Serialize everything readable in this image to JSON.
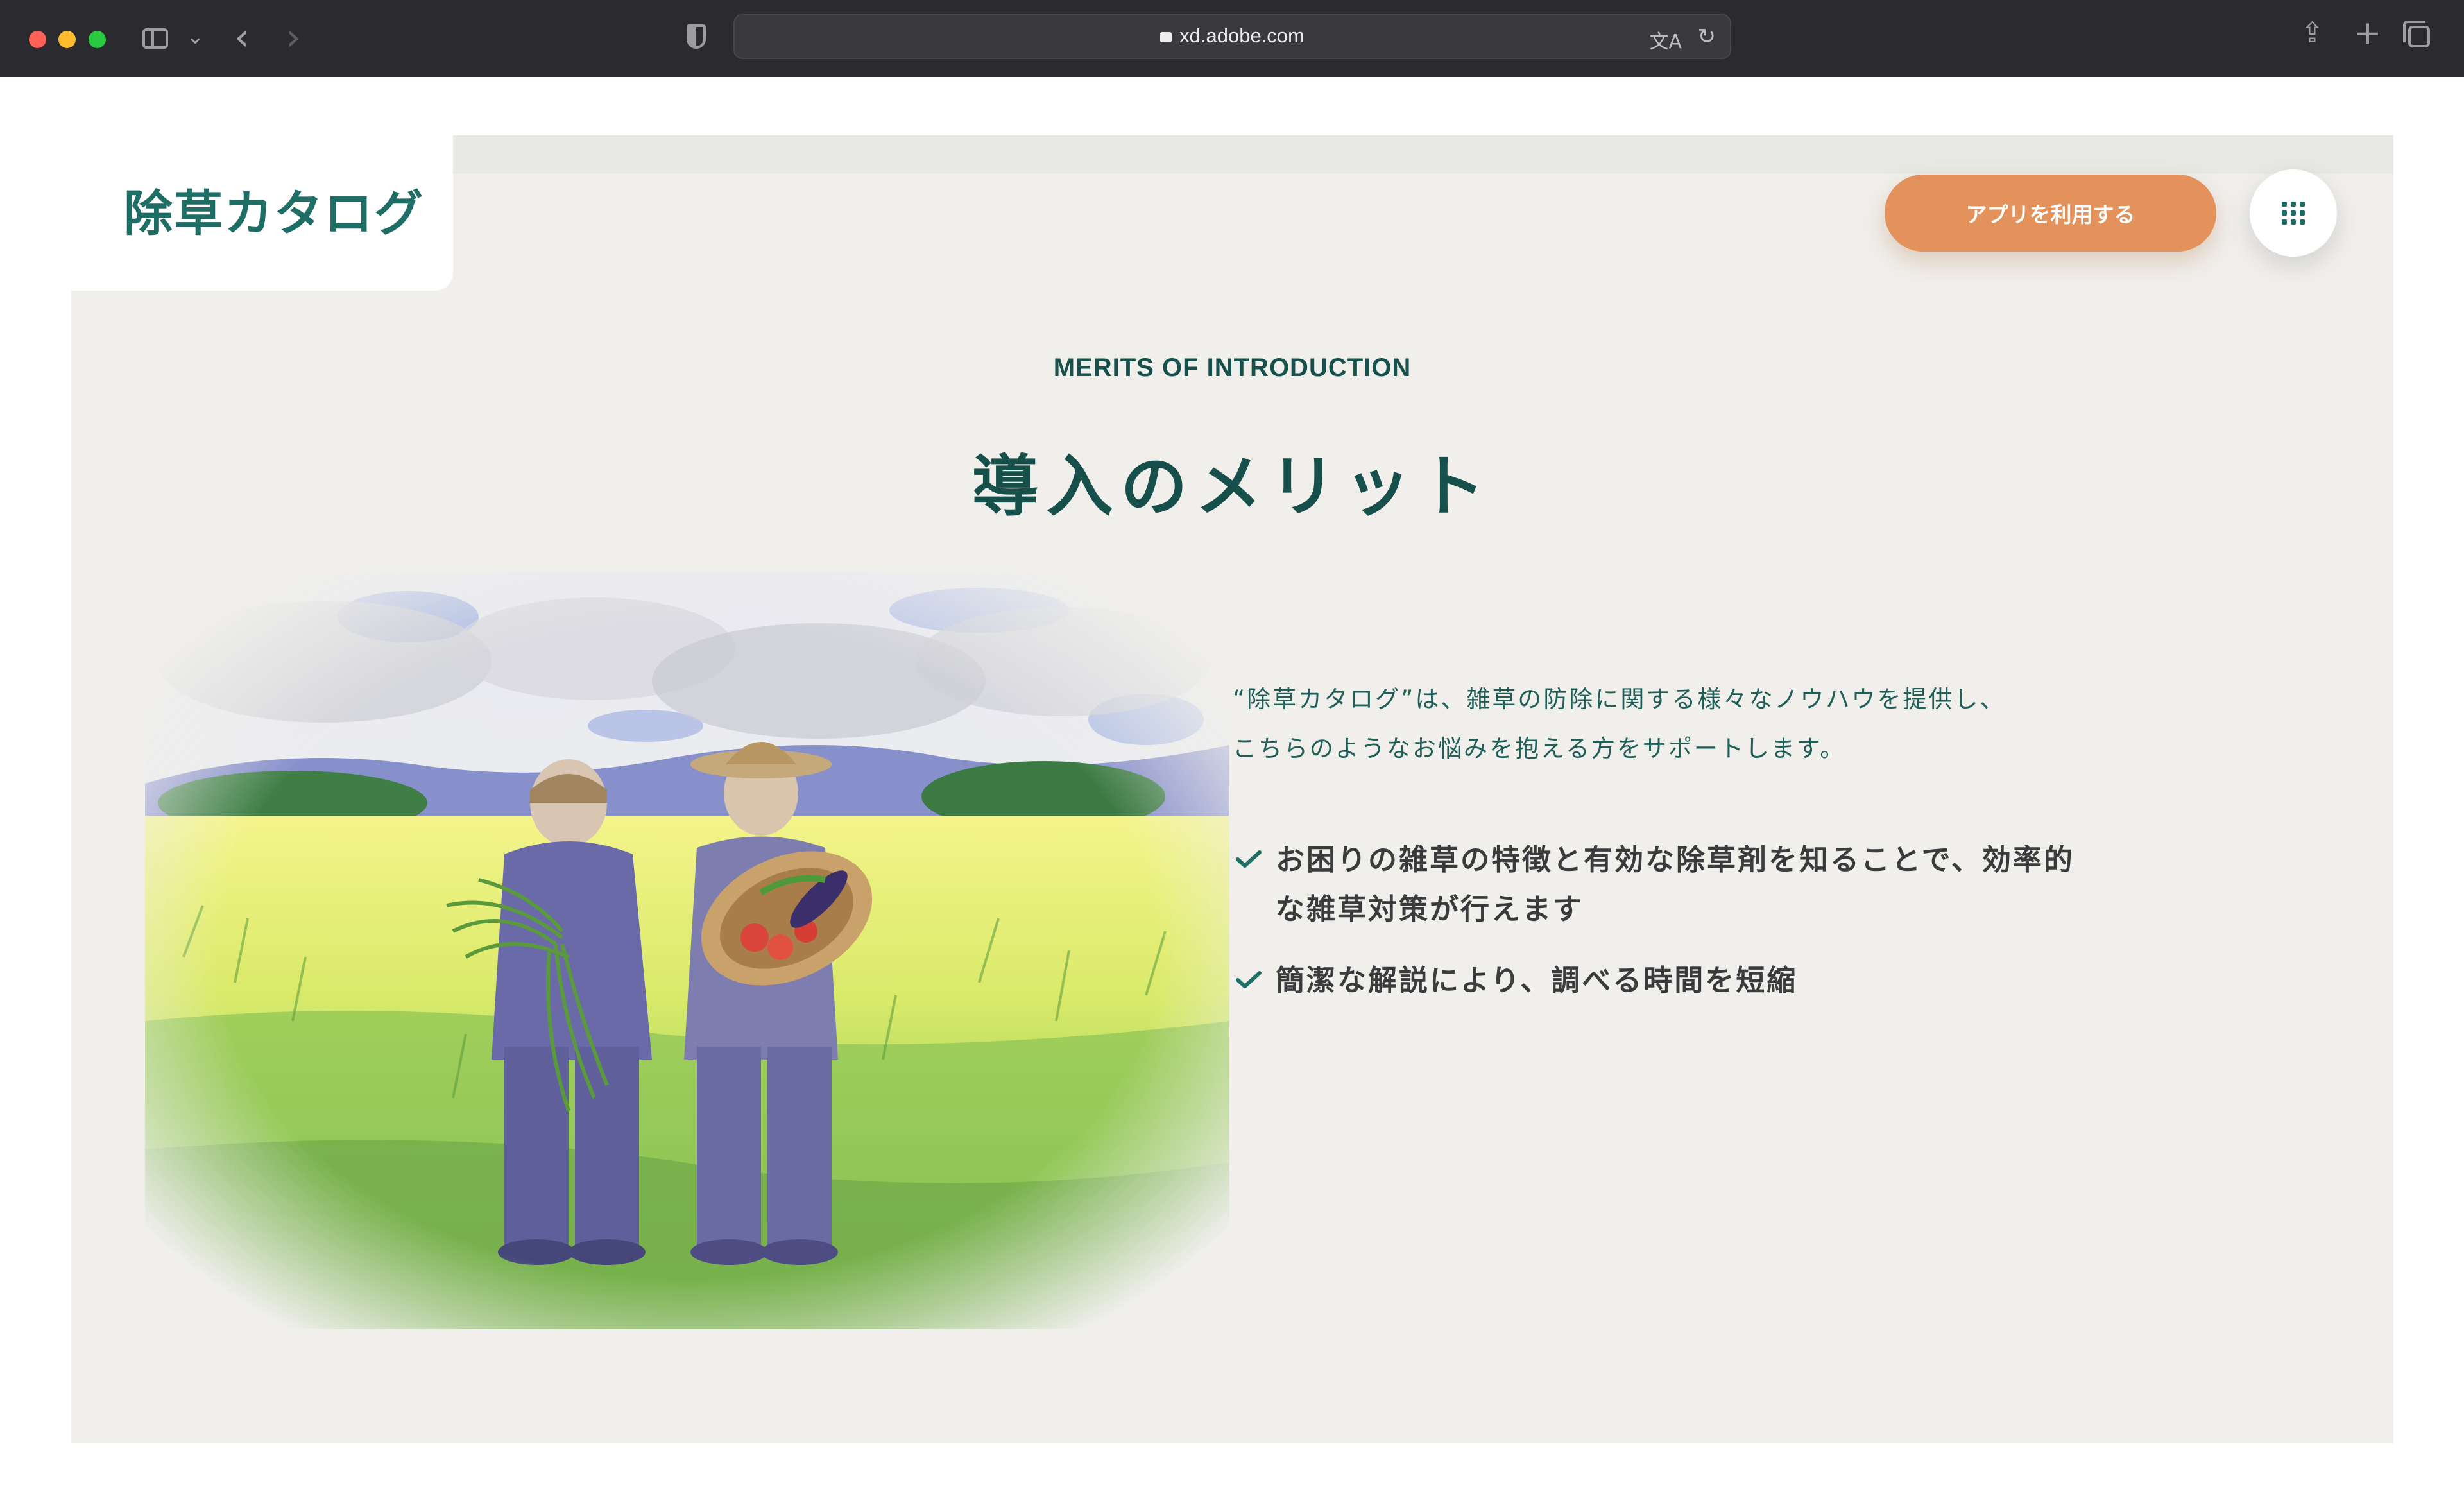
{
  "browser": {
    "url": "xd.adobe.com",
    "icons": [
      "sidebar-icon",
      "chevron-down-icon",
      "back-icon",
      "forward-icon",
      "shield-icon",
      "lock-icon",
      "translate-icon",
      "reload-icon",
      "share-icon",
      "new-tab-icon",
      "tabs-overview-icon"
    ]
  },
  "header": {
    "logo": "除草カタログ",
    "cta_label": "アプリを利用する",
    "menu_icon": "grid-icon"
  },
  "section": {
    "eyebrow": "MERITS OF INTRODUCTION",
    "title": "導入のメリット",
    "intro_line1": "“除草カタログ”は、雑草の防除に関する様々なノウハウを提供し、",
    "intro_line2": "こちらのようなお悩みを抱える方をサポートします。",
    "merits": [
      {
        "line1": "お困りの雑草の特徴と有効な除草剤を知ることで、効率的",
        "line2": "な雑草対策が行えます"
      },
      {
        "line1": "簡潔な解説により、調べる時間を短縮",
        "line2": ""
      }
    ]
  },
  "colors": {
    "brand": "#1f6e66",
    "heading": "#174f4a",
    "cta": "#e2925a",
    "background": "#f0efec"
  }
}
